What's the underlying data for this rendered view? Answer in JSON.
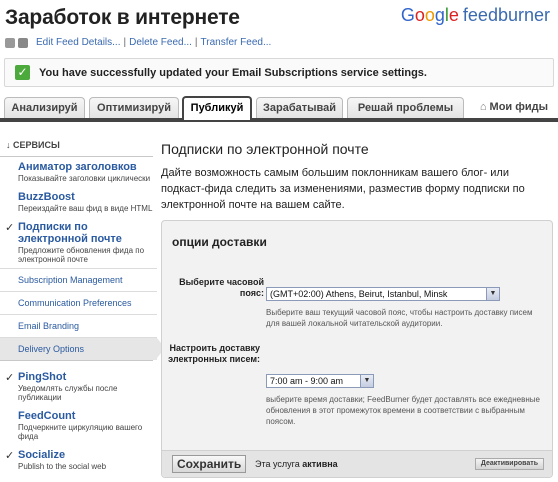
{
  "header": {
    "title": "Заработок в интернете",
    "logo": {
      "g1": "G",
      "g2": "o",
      "g3": "o",
      "g4": "g",
      "g5": "l",
      "g6": "e",
      "brand": "feedburner"
    },
    "links": [
      "Edit Feed Details...",
      "Delete Feed...",
      "Transfer Feed..."
    ],
    "separator": "|"
  },
  "banner": {
    "check": "✓",
    "text": "You have successfully updated your Email Subscriptions service settings."
  },
  "tabs": [
    {
      "label": "Анализируй"
    },
    {
      "label": "Оптимизируй"
    },
    {
      "label": "Публикуй"
    },
    {
      "label": "Зарабатывай"
    },
    {
      "label": "Решай проблемы"
    }
  ],
  "my_feeds": {
    "icon": "⌂",
    "label": "Мои фиды"
  },
  "sidebar": {
    "section": "↓ СЕРВИСЫ",
    "items": [
      {
        "title": "Аниматор заголовков",
        "desc": "Показывайте заголовки циклически",
        "checked": false
      },
      {
        "title": "BuzzBoost",
        "desc": "Переиздайте ваш фид в виде HTML",
        "checked": false
      },
      {
        "title": "Подписки по электронной почте",
        "desc": "Предложите обновления фида по электронной почте",
        "checked": true
      }
    ],
    "check_mark": "✓",
    "sub_items": [
      {
        "label": "Subscription Management"
      },
      {
        "label": "Communication Preferences"
      },
      {
        "label": "Email Branding"
      },
      {
        "label": "Delivery Options"
      }
    ],
    "more_items": [
      {
        "title": "PingShot",
        "desc": "Уведомлять службы после публикации",
        "checked": true
      },
      {
        "title": "FeedCount",
        "desc": "Подчеркните циркуляцию вашего фида",
        "checked": false
      },
      {
        "title": "Socialize",
        "desc": "Publish to the social web",
        "checked": true
      }
    ]
  },
  "main": {
    "heading": "Подписки по электронной почте",
    "intro": "Дайте возможность самым большим поклонникам вашего блог- или подкаст-фида следить за изменениями, разместив форму подписки по электронной почте на вашем сайте."
  },
  "panel": {
    "title": "опции доставки",
    "timezone_label": "Выберите часовой пояс:",
    "timezone_value": "(GMT+02:00) Athens, Beirut, Istanbul, Minsk",
    "timezone_hint": "Выберите ваш текущий часовой пояс, чтобы настроить доставку писем для вашей локальной читательской аудитории.",
    "delivery_label": "Настроить доставку электронных писем:",
    "delivery_value": "7:00 am - 9:00 am",
    "delivery_hint": "выберите время доставки; FeedBurner будет доставлять все ежедневные обновления в этот промежуток времени в соответствии с выбранным поясом.",
    "arrow": "▼",
    "save_label": "Сохранить",
    "status_prefix": "Эта услуга",
    "status_value": "активна",
    "deactivate_label": "Деактивировать"
  }
}
